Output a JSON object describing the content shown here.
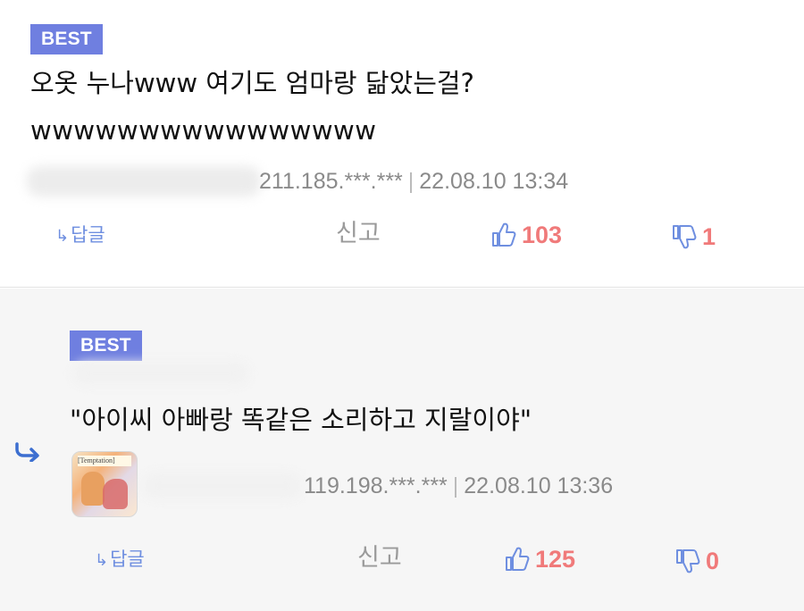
{
  "comments": [
    {
      "badge": "BEST",
      "text_lines": [
        "오옷 누나www 여기도 엄마랑 닮았는걸?",
        "wwwwwwwwwwwwwwww"
      ],
      "ip": "211.185.***.***",
      "separator": "|",
      "datetime": "22.08.10 13:34",
      "reply_label": "답글",
      "report_label": "신고",
      "likes": "103",
      "dislikes": "1"
    },
    {
      "badge": "BEST",
      "text": "\"아이씨 아빠랑 똑같은 소리하고 지랄이야\"",
      "ip": "119.198.***.***",
      "separator": "|",
      "datetime": "22.08.10 13:36",
      "avatar_tag": "[Temptation]",
      "reply_label": "답글",
      "report_label": "신고",
      "likes": "125",
      "dislikes": "0"
    }
  ],
  "colors": {
    "badge": "#6f7fe0",
    "vote": "#f07a7a",
    "icon": "#6f8fe0",
    "meta": "#8a8a8a"
  },
  "icons": {
    "reply": "reply-arrow-icon",
    "like": "thumbs-up-icon",
    "dislike": "thumbs-down-icon",
    "nested": "nested-reply-arrow-icon"
  }
}
